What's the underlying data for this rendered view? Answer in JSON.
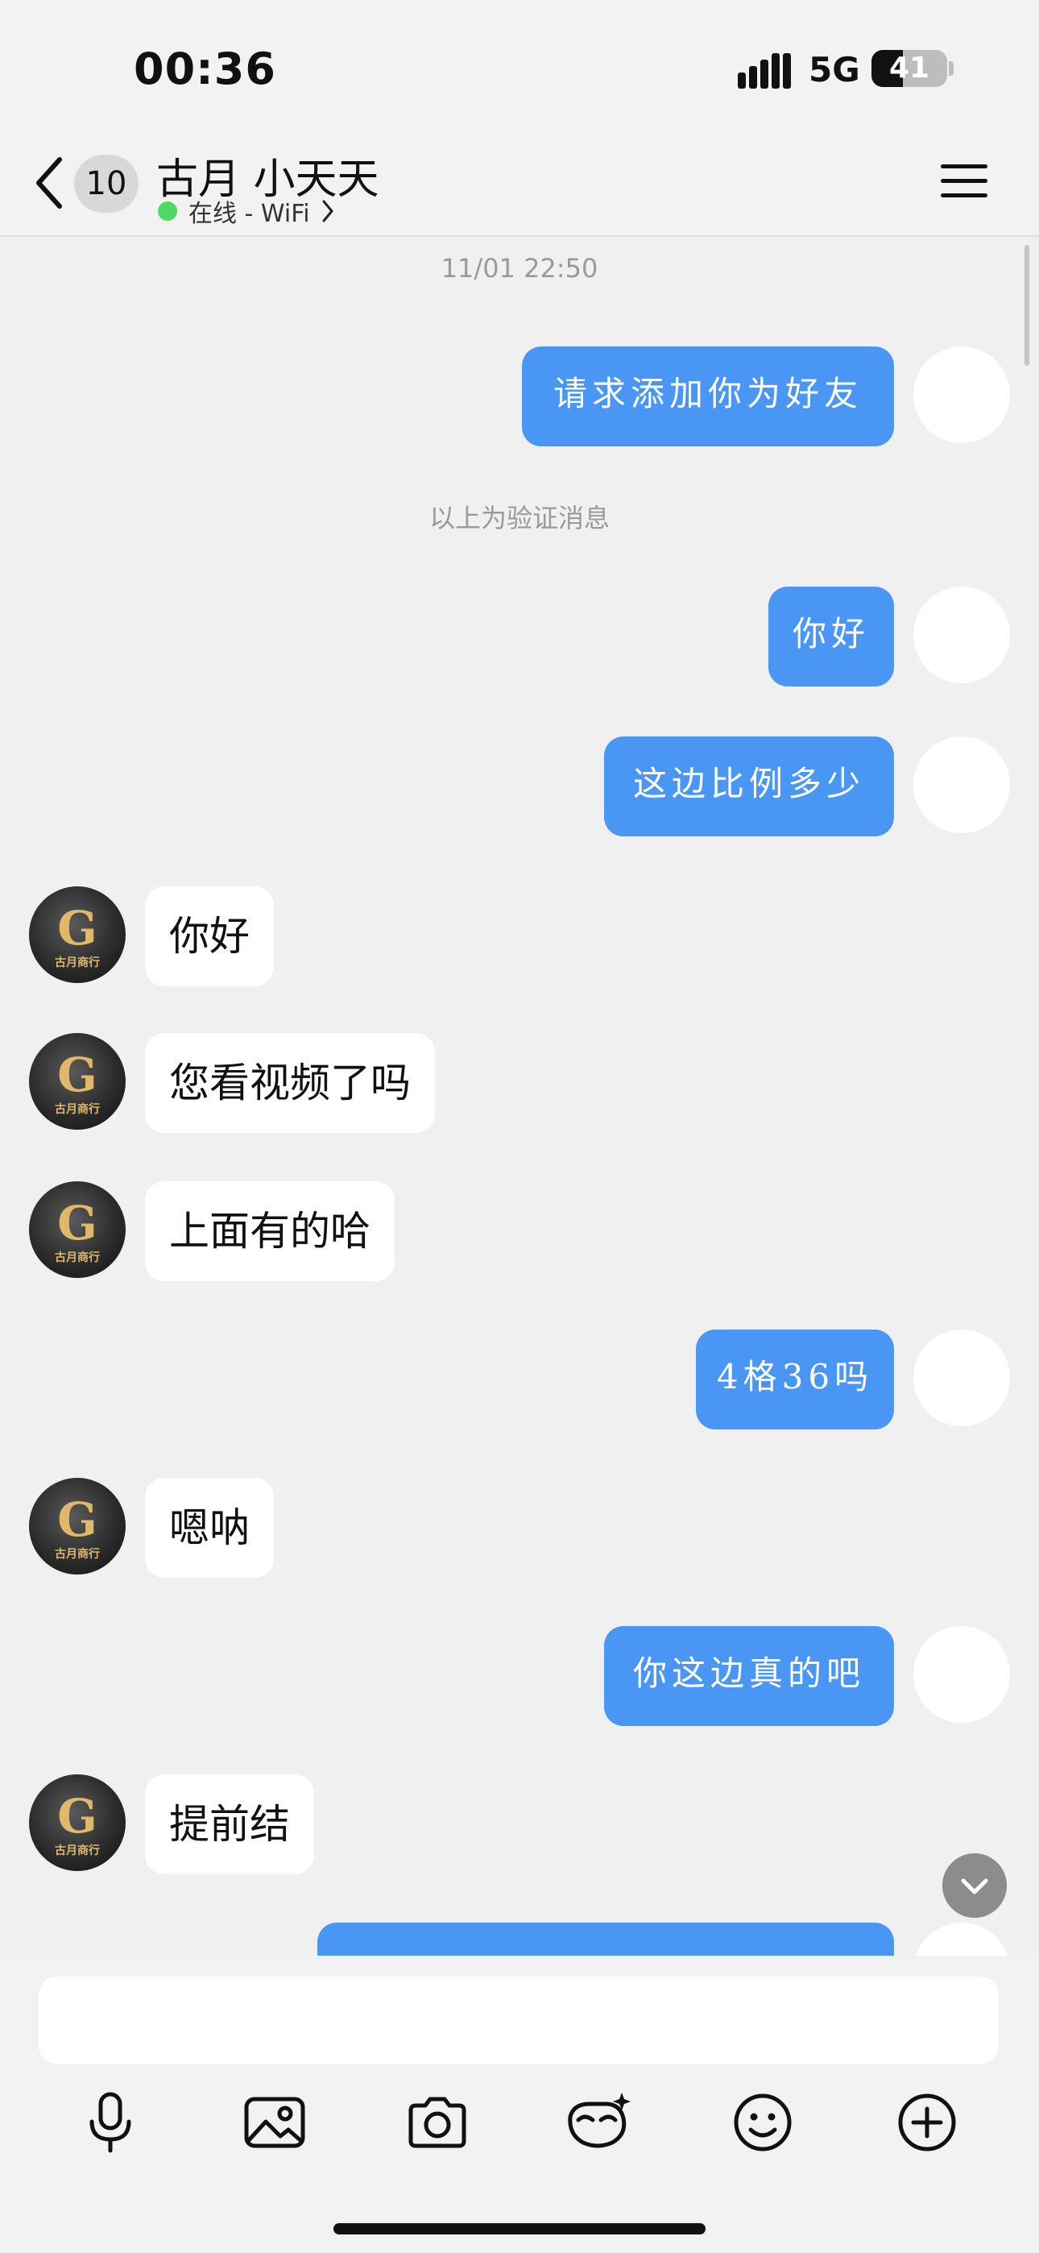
{
  "status_bar": {
    "time": "00:36",
    "network": "5G",
    "battery": "41",
    "battery_level": 0.41
  },
  "header": {
    "back_icon": "chevron-left-icon",
    "unread_count": "10",
    "title": "古月 小天天",
    "status": "在线 - WiFi",
    "menu_icon": "hamburger-menu-icon"
  },
  "chat": {
    "timestamp": "11/01 22:50",
    "verification_notice": "以上为验证消息",
    "messages": [
      {
        "from": "me",
        "text": "请求添加你为好友"
      },
      {
        "from": "me",
        "text": "你好"
      },
      {
        "from": "me",
        "text": "这边比例多少"
      },
      {
        "from": "them",
        "text": "你好"
      },
      {
        "from": "them",
        "text": "您看视频了吗"
      },
      {
        "from": "them",
        "text": "上面有的哈"
      },
      {
        "from": "me",
        "text": "4格36吗"
      },
      {
        "from": "them",
        "text": "嗯呐"
      },
      {
        "from": "me",
        "text": "你这边真的吧"
      },
      {
        "from": "them",
        "text": "提前结"
      }
    ],
    "contact_avatar_logo": "古月商行"
  },
  "input_bar": {
    "text_value": "",
    "tools": [
      "microphone-icon",
      "image-icon",
      "camera-icon",
      "ai-mask-icon",
      "emoji-icon",
      "plus-icon"
    ]
  },
  "colors": {
    "outgoing_bubble": "#4a96f5",
    "incoming_bubble": "#ffffff",
    "background": "#f0f0f0",
    "online_dot": "#4cd964"
  }
}
